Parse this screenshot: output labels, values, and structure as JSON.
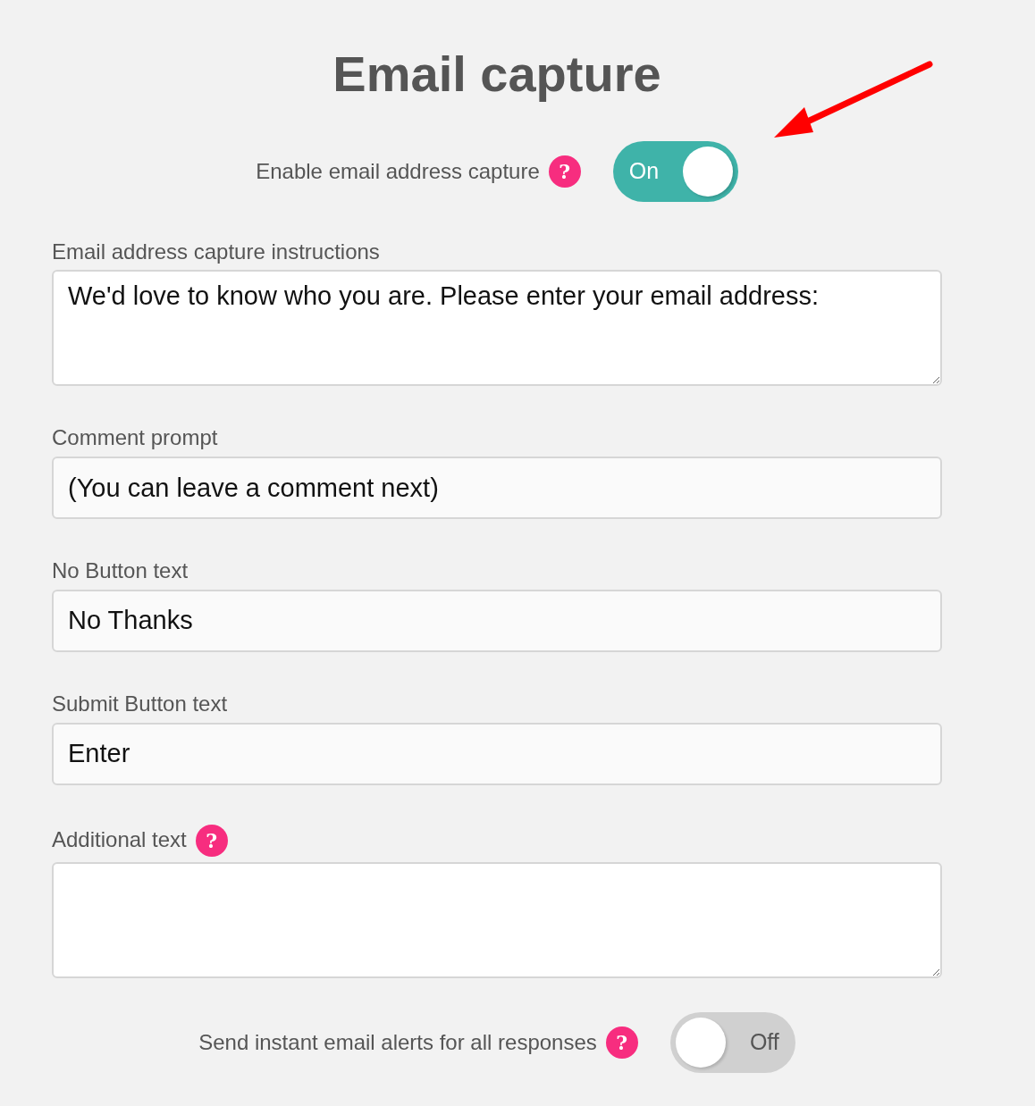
{
  "title": "Email capture",
  "capture_toggle": {
    "label": "Enable email address capture",
    "help": "?",
    "on": true,
    "state_text": "On"
  },
  "fields": [
    {
      "kind": "textarea",
      "label": "Email address capture instructions",
      "value": "We'd love to know who you are. Please enter your email address:"
    },
    {
      "kind": "input",
      "label": "Comment prompt",
      "value": "(You can leave a comment next)"
    },
    {
      "kind": "input",
      "label": "No Button text",
      "value": "No Thanks"
    },
    {
      "kind": "input",
      "label": "Submit Button text",
      "value": "Enter"
    },
    {
      "kind": "textarea",
      "label": "Additional text",
      "help": "?"
    }
  ],
  "alerts_toggle": {
    "label": "Send instant email alerts for all responses",
    "help": "?",
    "on": false,
    "state_text": "Off"
  }
}
